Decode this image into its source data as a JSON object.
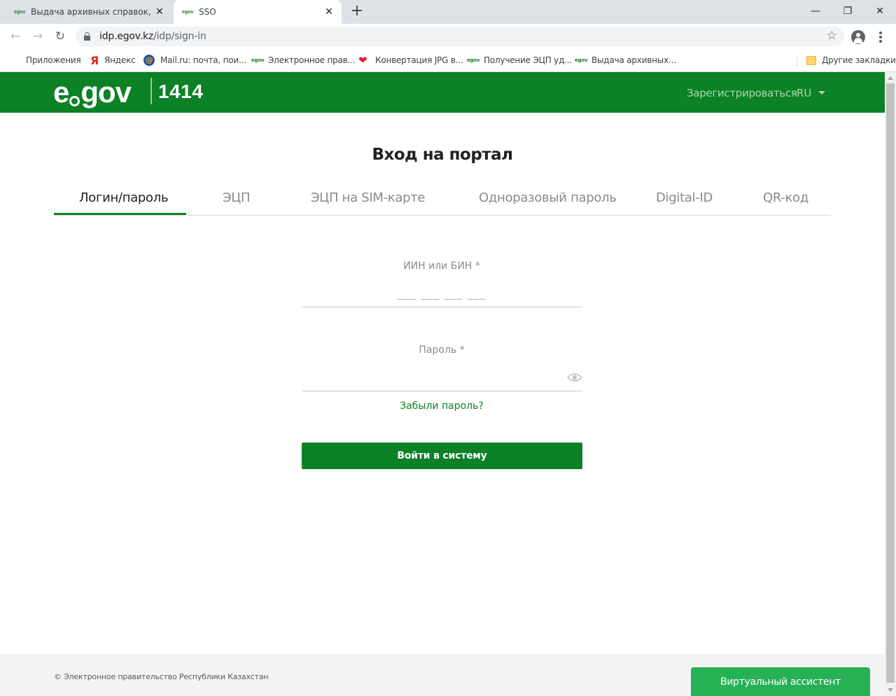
{
  "browser": {
    "tabs": [
      {
        "favicon": "egov",
        "title": "Выдача архивных справок, коп"
      },
      {
        "favicon": "egov",
        "title": "SSO"
      }
    ],
    "new_tab_glyph": "+",
    "close_glyph": "✕",
    "window_controls": {
      "minimize": "—",
      "restore": "❐",
      "close": "✕"
    },
    "address": {
      "host": "idp.egov.kz",
      "path": "/idp/sign-in"
    },
    "bookmarks": [
      {
        "icon": "apps-grid-icon",
        "label": "Приложения"
      },
      {
        "icon": "yandex-icon",
        "glyph": "Я",
        "label": "Яндекс"
      },
      {
        "icon": "mailru-icon",
        "glyph": "@",
        "label": "Mail.ru: почта, пои..."
      },
      {
        "icon": "egov-icon",
        "glyph": "egov",
        "label": "Электронное прав..."
      },
      {
        "icon": "heart-icon",
        "glyph": "❤",
        "label": "Конвертация JPG в..."
      },
      {
        "icon": "egov-icon",
        "glyph": "egov",
        "label": "Получение ЭЦП уд..."
      },
      {
        "icon": "egov-icon",
        "glyph": "egov",
        "label": "Выдача архивных..."
      },
      {
        "icon": "folder-icon",
        "label": "Другие закладки"
      }
    ]
  },
  "header": {
    "logo_left": "e",
    "logo_right": "gov",
    "logo_number": "1414",
    "register_link": "Зарегистрироваться",
    "language": "RU",
    "background_color": "#0c8126"
  },
  "main": {
    "title": "Вход на портал",
    "tabs": [
      {
        "label": "Логин/пароль",
        "active": true
      },
      {
        "label": "ЭЦП",
        "active": false
      },
      {
        "label": "ЭЦП на SIM-карте",
        "active": false
      },
      {
        "label": "Одноразовый пароль",
        "active": false
      },
      {
        "label": "Digital-ID",
        "active": false
      },
      {
        "label": "QR-код",
        "active": false
      }
    ],
    "iin_field": {
      "label": "ИИН или БИН *",
      "placeholder": "___ ___ ___ ___",
      "value": ""
    },
    "password_field": {
      "label": "Пароль *",
      "value": ""
    },
    "forgot_password": "Забыли пароль?",
    "submit_button": "Войти в систему",
    "accent_color": "#0c8126"
  },
  "footer": {
    "copyright": "© Электронное правительство Республики Казахстан",
    "assistant_button": "Виртуальный ассистент",
    "assistant_color": "#26b155"
  }
}
